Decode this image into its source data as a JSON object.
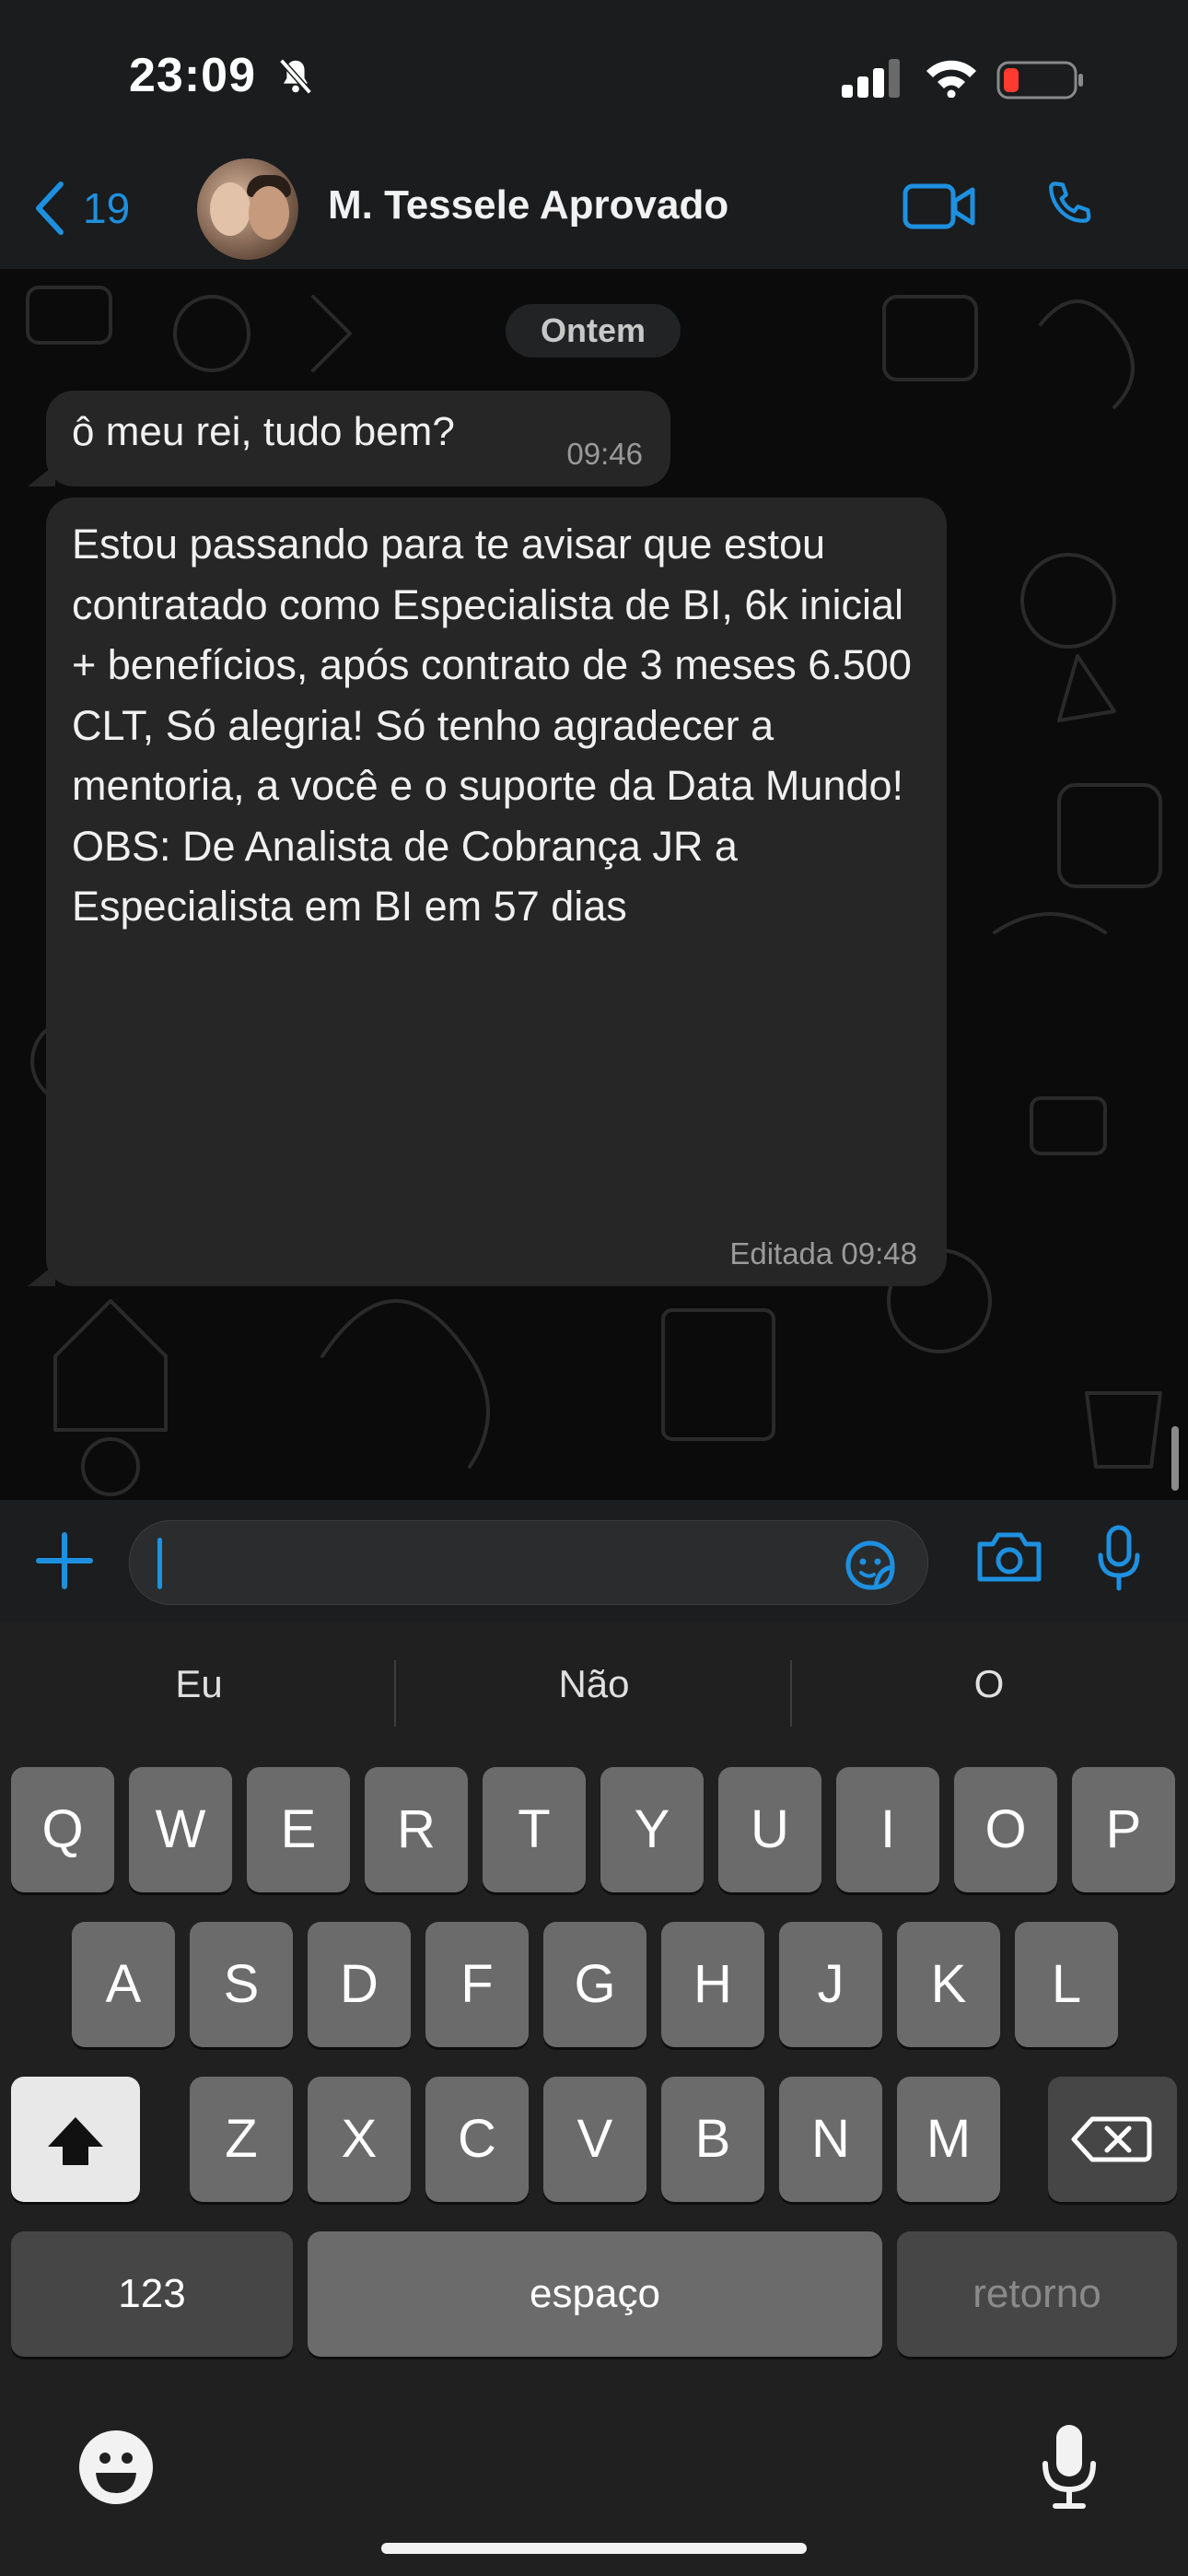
{
  "status_bar": {
    "time": "23:09"
  },
  "header": {
    "back_count": "19",
    "contact_name": "M. Tessele Aprovado"
  },
  "chat": {
    "date_label": "Ontem",
    "messages": [
      {
        "text": "ô meu rei, tudo bem?",
        "time": "09:46"
      },
      {
        "text": "Estou passando para te avisar que estou contratado como Especialista de BI, 6k inicial + benefícios, após contrato de 3 meses 6.500 CLT, Só alegria! Só tenho agradecer a mentoria, a você e o suporte da Data Mundo! OBS: De Analista de Cobrança JR a Especialista em BI em 57 dias",
        "time": "Editada 09:48"
      }
    ]
  },
  "composer": {
    "value": ""
  },
  "keyboard": {
    "suggestions": [
      "Eu",
      "Não",
      "O"
    ],
    "row1": [
      "Q",
      "W",
      "E",
      "R",
      "T",
      "Y",
      "U",
      "I",
      "O",
      "P"
    ],
    "row2": [
      "A",
      "S",
      "D",
      "F",
      "G",
      "H",
      "J",
      "K",
      "L"
    ],
    "row3": [
      "Z",
      "X",
      "C",
      "V",
      "B",
      "N",
      "M"
    ],
    "numbers_label": "123",
    "space_label": "espaço",
    "return_label": "retorno"
  },
  "colors": {
    "accent": "#1e90e0",
    "bubble": "#262627",
    "background": "#0b0b0b"
  }
}
